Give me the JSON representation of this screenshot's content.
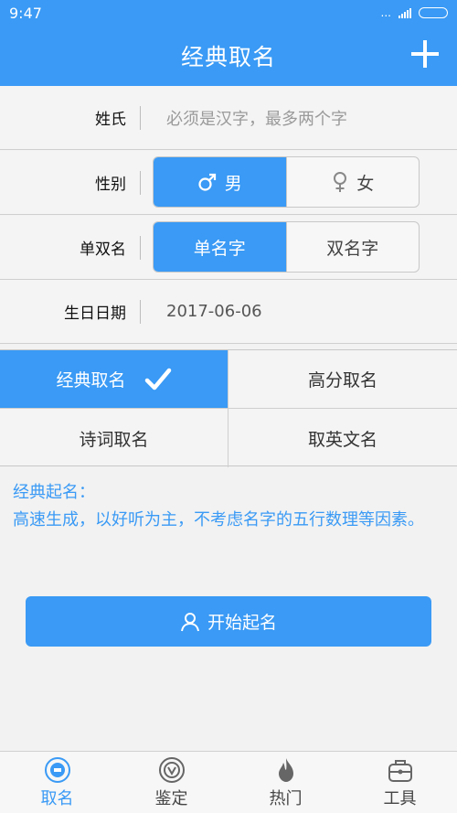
{
  "status": {
    "time": "9:47",
    "dots": "..."
  },
  "header": {
    "title": "经典取名"
  },
  "form": {
    "surname_label": "姓氏",
    "surname_placeholder": "必须是汉字，最多两个字",
    "gender_label": "性别",
    "gender_options": [
      {
        "label": "男",
        "icon": "male-icon",
        "selected": true
      },
      {
        "label": "女",
        "icon": "female-icon",
        "selected": false
      }
    ],
    "name_length_label": "单双名",
    "name_length_options": [
      {
        "label": "单名字",
        "selected": true
      },
      {
        "label": "双名字",
        "selected": false
      }
    ],
    "birthday_label": "生日日期",
    "birthday_value": "2017-06-06"
  },
  "modes": [
    {
      "label": "经典取名",
      "selected": true
    },
    {
      "label": "高分取名",
      "selected": false
    },
    {
      "label": "诗词取名",
      "selected": false
    },
    {
      "label": "取英文名",
      "selected": false
    }
  ],
  "description": {
    "title": "经典起名：",
    "body": "高速生成，以好听为主，不考虑名字的五行数理等因素。"
  },
  "start_button": {
    "label": "开始起名",
    "icon": "user-icon"
  },
  "nav": [
    {
      "label": "取名",
      "icon": "name-badge-icon",
      "active": true
    },
    {
      "label": "鉴定",
      "icon": "verify-icon",
      "active": false
    },
    {
      "label": "热门",
      "icon": "flame-icon",
      "active": false
    },
    {
      "label": "工具",
      "icon": "toolbox-icon",
      "active": false
    }
  ],
  "colors": {
    "primary": "#3a9af5",
    "background": "#f2f2f2"
  }
}
